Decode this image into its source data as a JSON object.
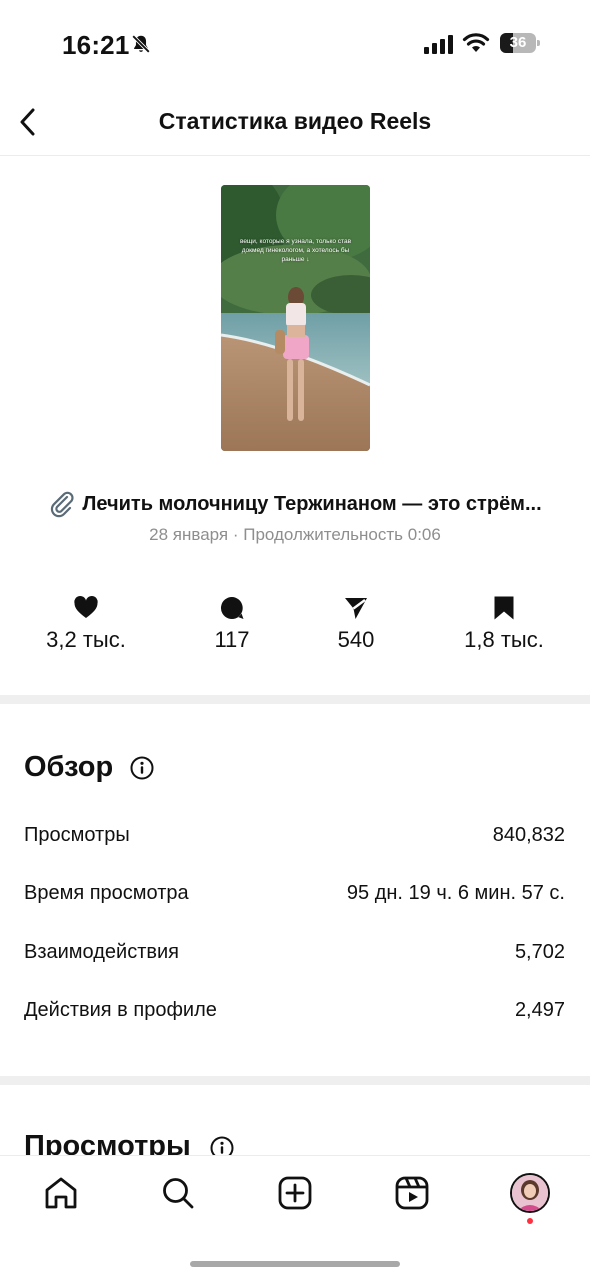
{
  "status_bar": {
    "time": "16:21",
    "battery_percent": 36,
    "battery_label": "36",
    "icons": [
      "bell-muted-icon",
      "signal-icon",
      "wifi-icon",
      "battery-icon"
    ]
  },
  "header": {
    "title": "Статистика видео Reels",
    "back_icon": "chevron-left-icon"
  },
  "reel": {
    "thumbnail_caption": "вещи, которые я узнала, только став докмед гинекологом, а хотелось бы раньше ↓",
    "title": "Лечить молочницу Тержинаном — это стрём...",
    "title_icon": "paperclip-icon",
    "meta": "28 января · Продолжительность 0:06"
  },
  "engagement": [
    {
      "icon": "heart-icon",
      "value": "3,2 тыс."
    },
    {
      "icon": "comment-icon",
      "value": "117"
    },
    {
      "icon": "send-icon",
      "value": "540"
    },
    {
      "icon": "bookmark-icon",
      "value": "1,8 тыс."
    }
  ],
  "overview": {
    "title": "Обзор",
    "rows": [
      {
        "label": "Просмотры",
        "value": "840,832"
      },
      {
        "label": "Время просмотра",
        "value": "95 дн. 19 ч. 6 мин. 57 с."
      },
      {
        "label": "Взаимодействия",
        "value": "5,702"
      },
      {
        "label": "Действия в профиле",
        "value": "2,497"
      }
    ]
  },
  "views_section": {
    "title": "Просмотры"
  },
  "bottom_nav": {
    "items": [
      "home-icon",
      "search-icon",
      "create-icon",
      "reels-icon",
      "profile-avatar"
    ],
    "notification_color": "#ff3040"
  }
}
